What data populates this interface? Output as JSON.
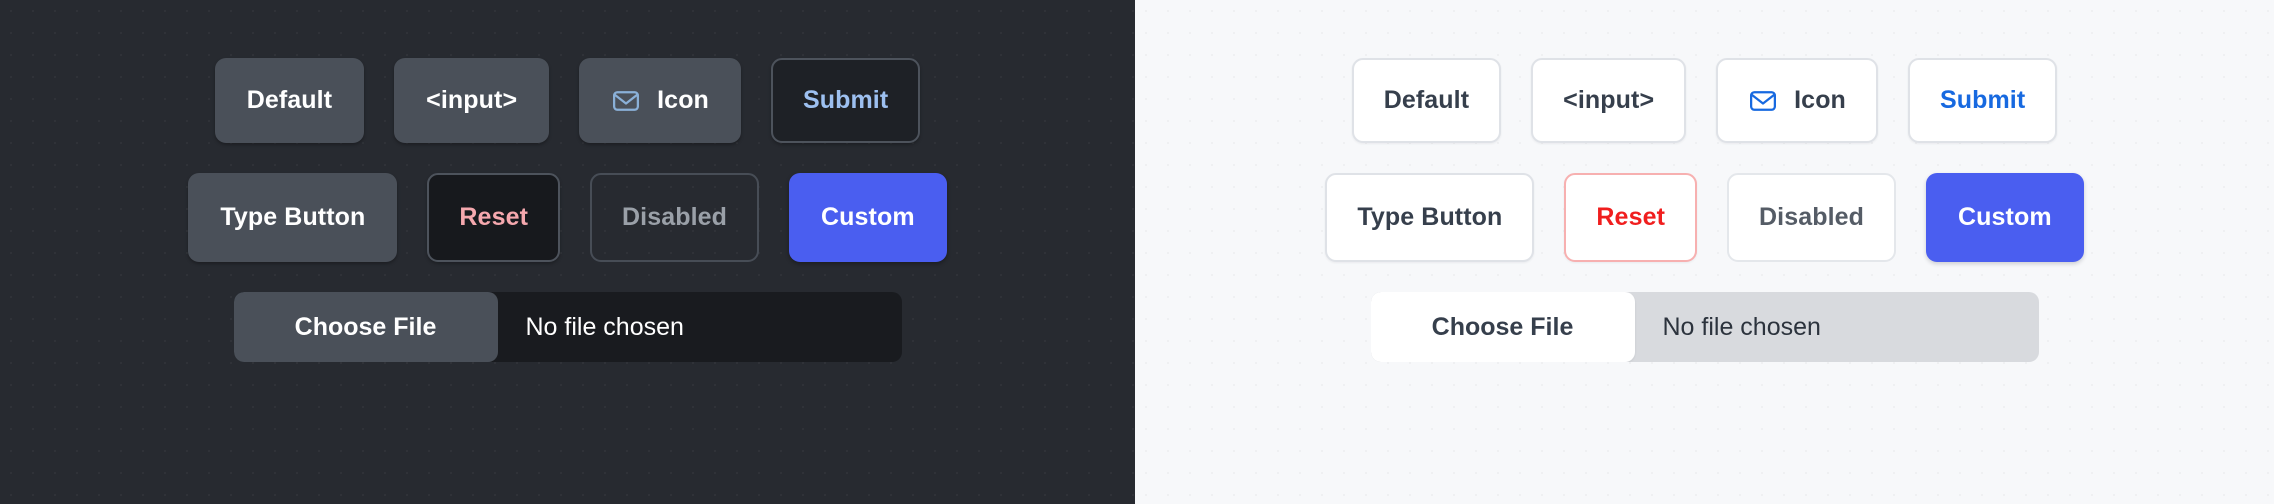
{
  "theme": {
    "dark_background": "#272a30",
    "light_background": "#f7f8fa",
    "accent_custom": "#4a5ef0",
    "accent_submit_dark": "#9dc0f0",
    "accent_submit_light": "#1769e0",
    "accent_reset_dark": "#f5a8ae",
    "accent_reset_light": "#f01e1e",
    "icon_color_dark": "#8ab0d8",
    "icon_color_light": "#1769e0"
  },
  "dark_panel": {
    "row1": [
      {
        "label": "Default",
        "name": "default-button"
      },
      {
        "label": "<input>",
        "name": "input-button"
      },
      {
        "label": "Icon",
        "name": "icon-button",
        "icon": "envelope-icon"
      },
      {
        "label": "Submit",
        "name": "submit-button"
      }
    ],
    "row2": [
      {
        "label": "Type Button",
        "name": "type-button"
      },
      {
        "label": "Reset",
        "name": "reset-button"
      },
      {
        "label": "Disabled",
        "name": "disabled-button"
      },
      {
        "label": "Custom",
        "name": "custom-button"
      }
    ],
    "file_input": {
      "button_label": "Choose File",
      "status_label": "No file chosen"
    }
  },
  "light_panel": {
    "row1": [
      {
        "label": "Default",
        "name": "default-button"
      },
      {
        "label": "<input>",
        "name": "input-button"
      },
      {
        "label": "Icon",
        "name": "icon-button",
        "icon": "envelope-icon"
      },
      {
        "label": "Submit",
        "name": "submit-button"
      }
    ],
    "row2": [
      {
        "label": "Type Button",
        "name": "type-button"
      },
      {
        "label": "Reset",
        "name": "reset-button"
      },
      {
        "label": "Disabled",
        "name": "disabled-button"
      },
      {
        "label": "Custom",
        "name": "custom-button"
      }
    ],
    "file_input": {
      "button_label": "Choose File",
      "status_label": "No file chosen"
    }
  }
}
